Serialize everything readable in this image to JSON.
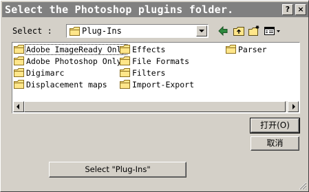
{
  "window": {
    "title": "Select the Photoshop plugins folder."
  },
  "titlebar_buttons": {
    "help": "?",
    "close": "×"
  },
  "look_in": {
    "label": "Select :",
    "value": "Plug-Ins"
  },
  "toolbar": {
    "back_icon": "back-arrow-icon",
    "up_icon": "up-folder-icon",
    "new_folder_icon": "new-folder-icon",
    "view_icon": "view-menu-icon"
  },
  "files": [
    {
      "name": "Adobe ImageReady Only",
      "focused": true
    },
    {
      "name": "Adobe Photoshop Only"
    },
    {
      "name": "Digimarc"
    },
    {
      "name": "Displacement maps"
    },
    {
      "name": "Effects"
    },
    {
      "name": "File Formats"
    },
    {
      "name": "Filters"
    },
    {
      "name": "Import-Export"
    },
    {
      "name": "Parser"
    }
  ],
  "buttons": {
    "open": "打开(O)",
    "cancel": "取消",
    "select": "Select \"Plug-Ins\""
  },
  "colors": {
    "titlebar": "#808080",
    "face": "#d4d0c8",
    "folder": "#ffe68a"
  }
}
